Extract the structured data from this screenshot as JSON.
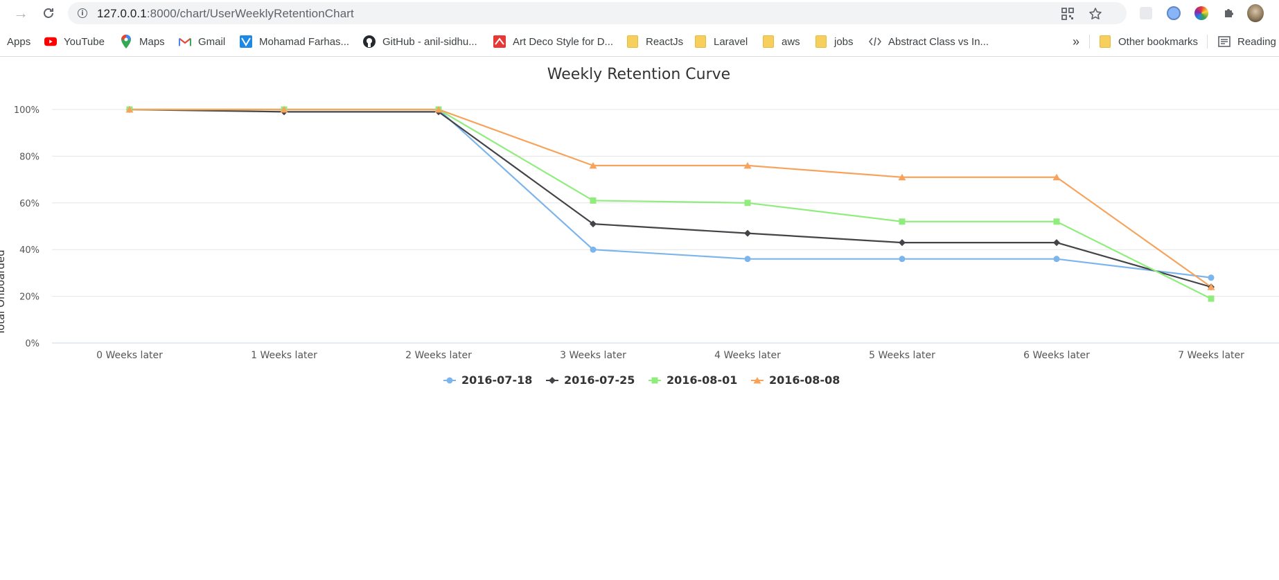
{
  "browser": {
    "url_host": "127.0.0.1",
    "url_rest": ":8000/chart/UserWeeklyRetentionChart",
    "bookmarks": [
      {
        "label": "Apps",
        "icon": "apps-grid-icon"
      },
      {
        "label": "YouTube",
        "icon": "youtube-icon"
      },
      {
        "label": "Maps",
        "icon": "maps-pin-icon"
      },
      {
        "label": "Gmail",
        "icon": "gmail-icon"
      },
      {
        "label": "Mohamad Farhas...",
        "icon": "site-icon"
      },
      {
        "label": "GitHub - anil-sidhu...",
        "icon": "github-icon"
      },
      {
        "label": "Art Deco Style for D...",
        "icon": "site-icon"
      },
      {
        "label": "ReactJs",
        "icon": "folder-icon"
      },
      {
        "label": "Laravel",
        "icon": "folder-icon"
      },
      {
        "label": "aws",
        "icon": "folder-icon"
      },
      {
        "label": "jobs",
        "icon": "folder-icon"
      },
      {
        "label": "Abstract Class vs In...",
        "icon": "code-icon"
      }
    ],
    "overflow_label": "»",
    "other_bookmarks": "Other bookmarks",
    "reading_list": "Reading"
  },
  "chart_data": {
    "type": "line",
    "title": "Weekly Retention Curve",
    "ylabel": "Total Onboarded",
    "xlabel": "",
    "categories": [
      "0 Weeks later",
      "1 Weeks later",
      "2 Weeks later",
      "3 Weeks later",
      "4 Weeks later",
      "5 Weeks later",
      "6 Weeks later",
      "7 Weeks later"
    ],
    "ylim": [
      0,
      100
    ],
    "yticks": [
      "0%",
      "20%",
      "40%",
      "60%",
      "80%",
      "100%"
    ],
    "grid": true,
    "legend": "bottom-center",
    "series": [
      {
        "name": "2016-07-18",
        "color": "#7cb5ec",
        "marker": "circle",
        "values": [
          100,
          100,
          100,
          40,
          36,
          36,
          36,
          28
        ]
      },
      {
        "name": "2016-07-25",
        "color": "#434348",
        "marker": "diamond",
        "values": [
          100,
          99,
          99,
          51,
          47,
          43,
          43,
          24
        ]
      },
      {
        "name": "2016-08-01",
        "color": "#90ed7d",
        "marker": "square",
        "values": [
          100,
          100,
          100,
          61,
          60,
          52,
          52,
          19
        ]
      },
      {
        "name": "2016-08-08",
        "color": "#f7a35c",
        "marker": "triangle",
        "values": [
          100,
          100,
          100,
          76,
          76,
          71,
          71,
          24
        ]
      }
    ]
  }
}
